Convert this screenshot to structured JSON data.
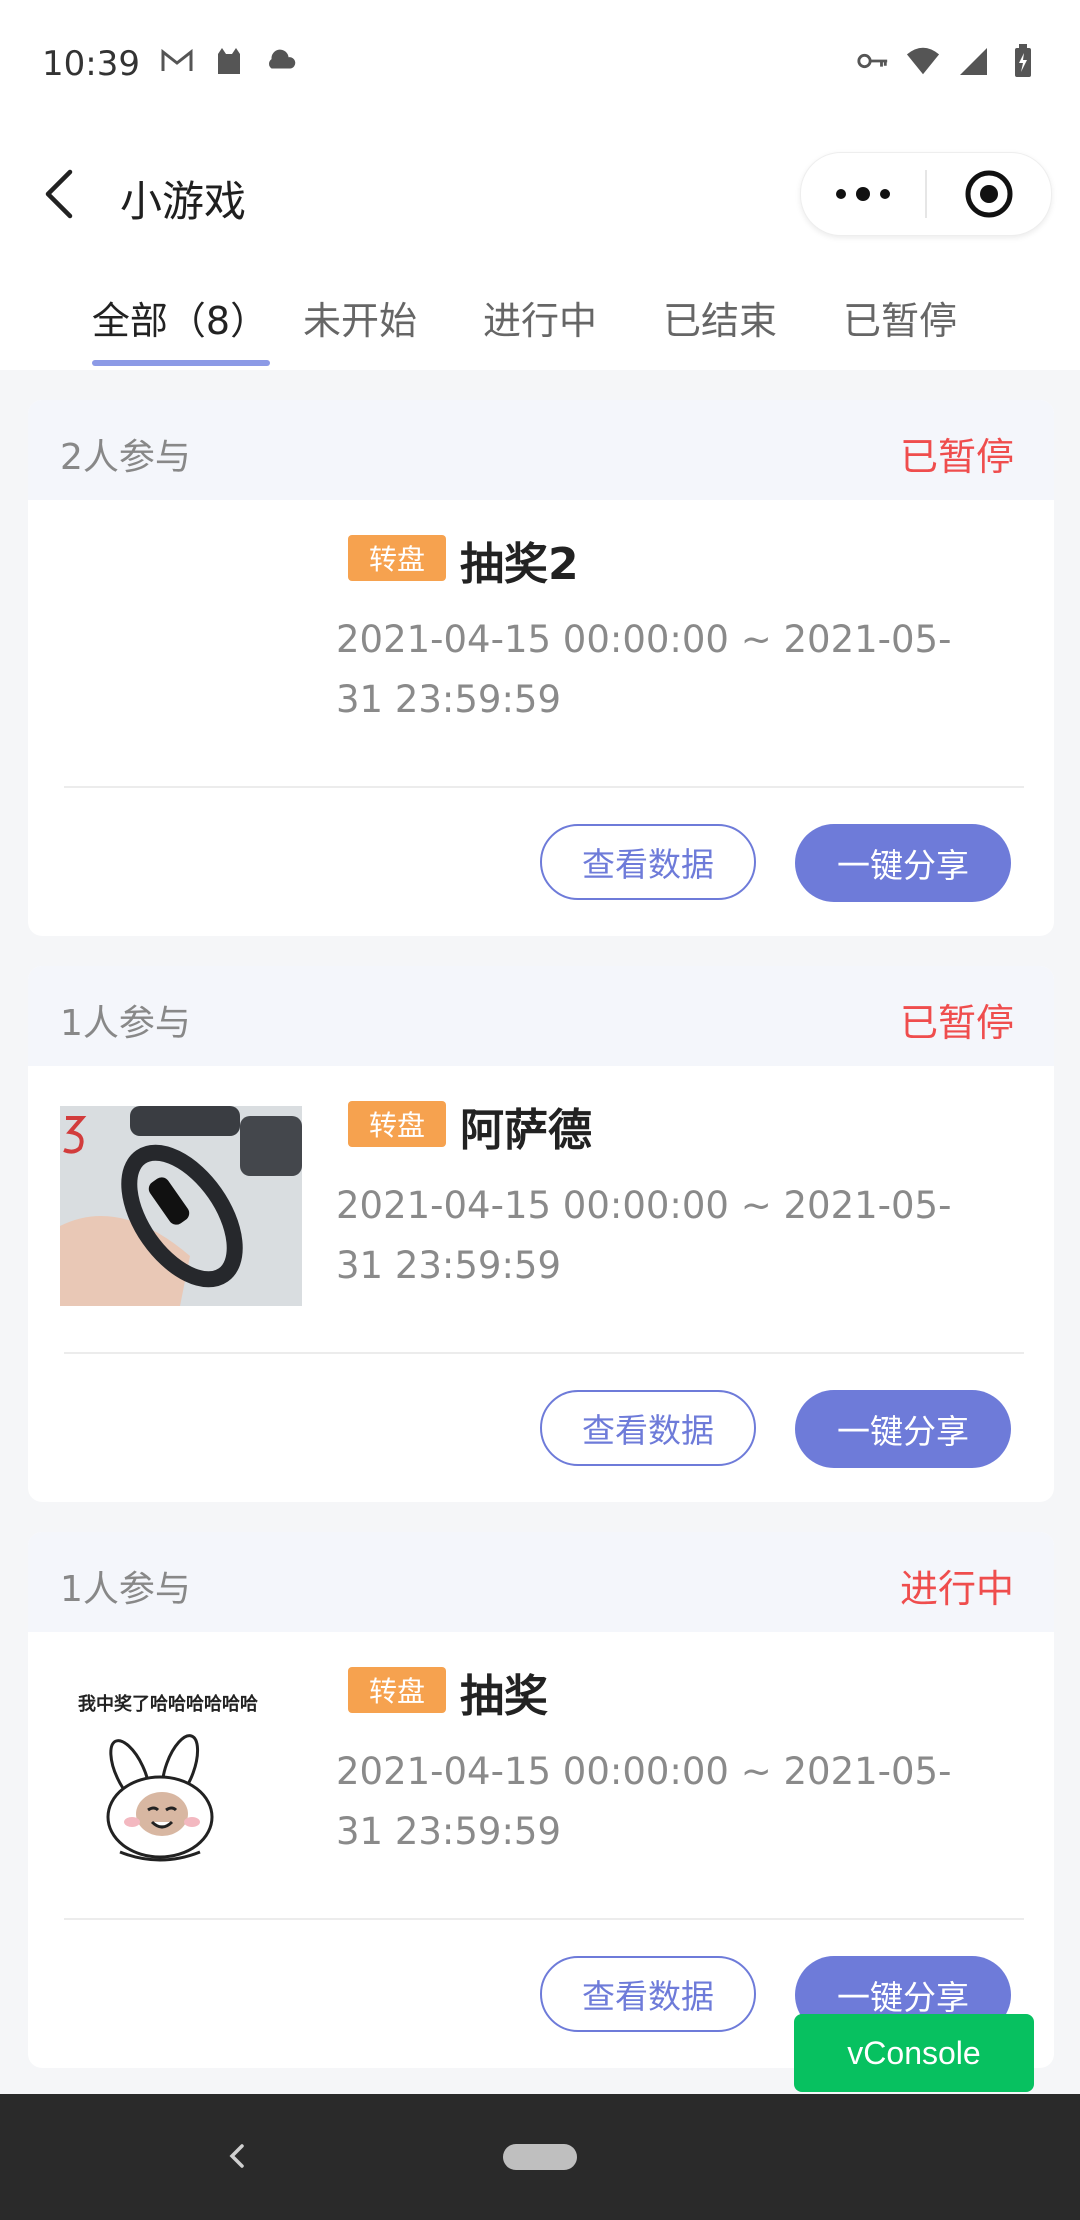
{
  "status_bar": {
    "time": "10:39",
    "left_icons": [
      "gmail-icon",
      "cat-app-icon",
      "cloud-icon"
    ],
    "right_icons": [
      "key-icon",
      "wifi-icon",
      "signal-icon",
      "battery-charging-icon"
    ]
  },
  "nav": {
    "title": "小游戏",
    "back_icon": "chevron-left-icon",
    "more_icon": "more-dots-icon",
    "close_icon": "target-circle-icon"
  },
  "tabs": [
    {
      "label": "全部（8）",
      "active": true
    },
    {
      "label": "未开始",
      "active": false
    },
    {
      "label": "进行中",
      "active": false
    },
    {
      "label": "已结束",
      "active": false
    },
    {
      "label": "已暂停",
      "active": false
    }
  ],
  "cards": [
    {
      "participants": "2人参与",
      "status": "已暂停",
      "tag": "转盘",
      "title": "抽奖2",
      "time_range": "2021-04-15 00:00:00 ~ 2021-05-31 23:59:59",
      "view_button": "查看数据",
      "share_button": "一键分享",
      "thumbnail": "none"
    },
    {
      "participants": "1人参与",
      "status": "已暂停",
      "tag": "转盘",
      "title": "阿萨德",
      "time_range": "2021-04-15 00:00:00 ~ 2021-05-31 23:59:59",
      "view_button": "查看数据",
      "share_button": "一键分享",
      "thumbnail": "fitness-band-photo"
    },
    {
      "participants": "1人参与",
      "status": "进行中",
      "tag": "转盘",
      "title": "抽奖",
      "time_range": "2021-04-15 00:00:00 ~ 2021-05-31 23:59:59",
      "view_button": "查看数据",
      "share_button": "一键分享",
      "thumbnail": "meme-rabbit",
      "thumbnail_caption": "我中奖了哈哈哈哈哈哈"
    }
  ],
  "vconsole": {
    "label": "vConsole"
  },
  "colors": {
    "accent": "#6e7bd9",
    "status_red": "#ef4d4d",
    "tag_orange": "#f6a24f",
    "vconsole_green": "#07c160"
  }
}
